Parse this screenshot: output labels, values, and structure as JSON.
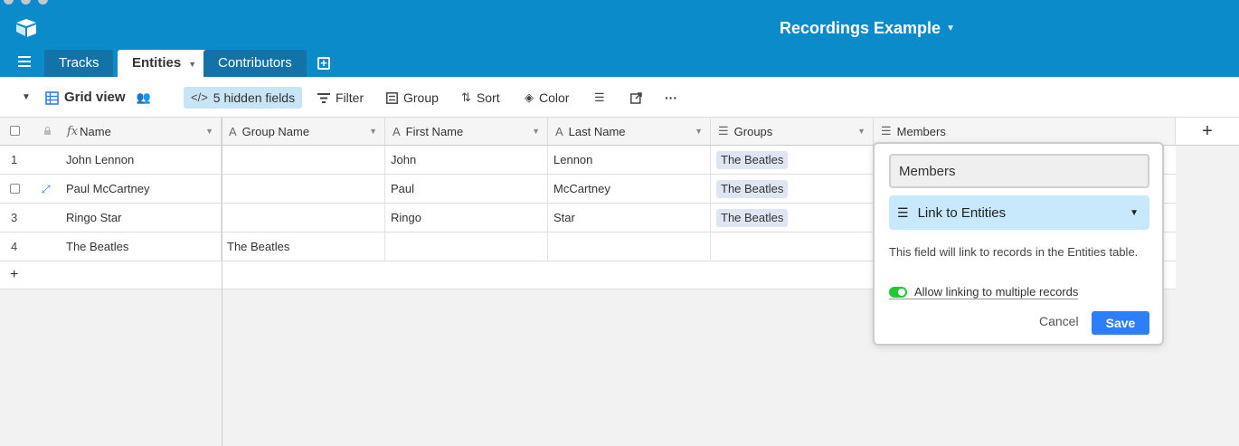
{
  "app": {
    "base_title": "Recordings Example"
  },
  "tabs": [
    {
      "label": "Tracks",
      "active": false
    },
    {
      "label": "Entities",
      "active": true
    },
    {
      "label": "Contributors",
      "active": false
    }
  ],
  "toolbar": {
    "view_name": "Grid view",
    "hidden_fields": "5 hidden fields",
    "filter": "Filter",
    "group": "Group",
    "sort": "Sort",
    "color": "Color",
    "more": "···"
  },
  "columns": [
    {
      "label": "Name",
      "icon": "formula-icon"
    },
    {
      "label": "Group Name",
      "icon": "text-icon"
    },
    {
      "label": "First Name",
      "icon": "text-icon"
    },
    {
      "label": "Last Name",
      "icon": "text-icon"
    },
    {
      "label": "Groups",
      "icon": "link-icon"
    },
    {
      "label": "Members",
      "icon": "link-icon"
    }
  ],
  "rows": [
    {
      "num": "1",
      "name": "John Lennon",
      "group_name": "",
      "first": "John",
      "last": "Lennon",
      "groups": "The Beatles"
    },
    {
      "num": "",
      "name": "Paul McCartney",
      "group_name": "",
      "first": "Paul",
      "last": "McCartney",
      "groups": "The Beatles"
    },
    {
      "num": "3",
      "name": "Ringo Star",
      "group_name": "",
      "first": "Ringo",
      "last": "Star",
      "groups": "The Beatles"
    },
    {
      "num": "4",
      "name": "The Beatles",
      "group_name": "The Beatles",
      "first": "",
      "last": "",
      "groups": ""
    }
  ],
  "add_row": "+",
  "add_column": "+",
  "popup": {
    "field_name": "Members",
    "field_type": "Link to Entities",
    "description": "This field will link to records in the Entities table.",
    "toggle_label": "Allow linking to multiple records",
    "toggle_on": true,
    "cancel": "Cancel",
    "save": "Save"
  },
  "colors": {
    "appbar": "#0b8bc9",
    "accent": "#2d7ff9",
    "chip": "#dfe6f3",
    "toggle_on": "#20c933"
  }
}
